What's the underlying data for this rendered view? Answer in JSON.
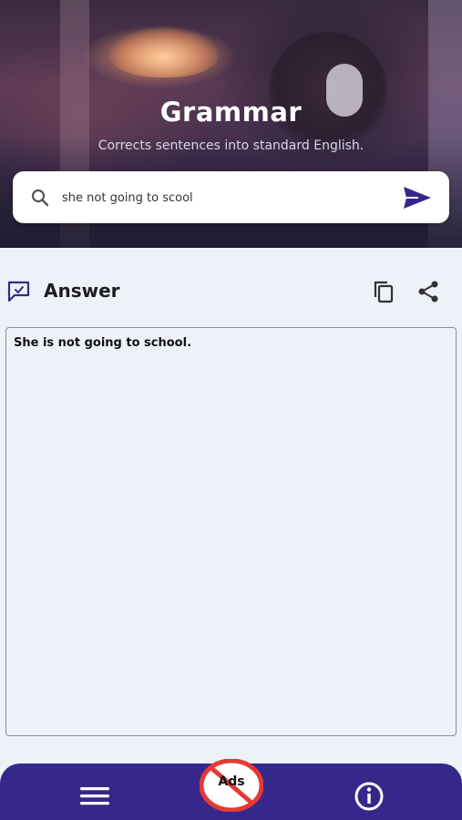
{
  "header": {
    "title": "Grammar",
    "subtitle": "Corrects sentences into standard English."
  },
  "search": {
    "value": "she not going to scool",
    "icon": "search-icon",
    "send_icon": "send-icon"
  },
  "answer": {
    "label": "Answer",
    "text": "She is not going to school.",
    "icons": [
      "answer-chat-icon",
      "copy-icon",
      "share-icon"
    ]
  },
  "bottom_nav": {
    "ads_label": "Ads",
    "items": [
      "menu-icon",
      "no-ads-icon",
      "info-icon"
    ]
  },
  "colors": {
    "accent": "#35288a",
    "background": "#eef1f7",
    "no_ads_red": "#e53935"
  }
}
